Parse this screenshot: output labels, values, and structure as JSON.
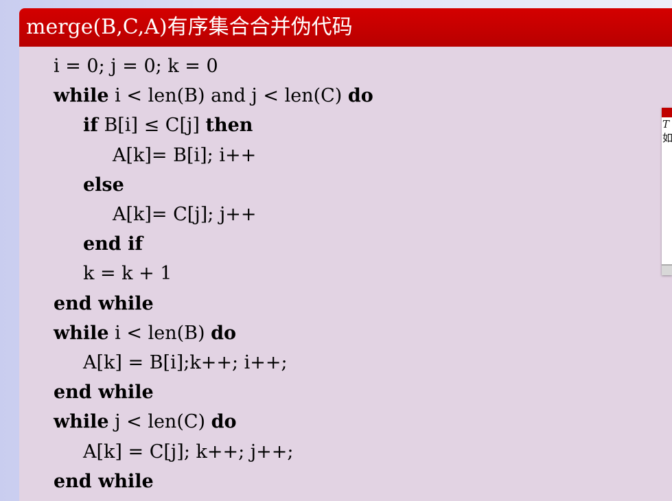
{
  "block": {
    "title": "merge(B,C,A)有序集合合并伪代码"
  },
  "code_lines": [
    {
      "indent": 0,
      "parts": [
        {
          "t": "i = 0; j = 0; k = 0",
          "b": false
        }
      ]
    },
    {
      "indent": 0,
      "parts": [
        {
          "t": "while",
          "b": true
        },
        {
          "t": " i < len(B) and j < len(C) ",
          "b": false
        },
        {
          "t": "do",
          "b": true
        }
      ]
    },
    {
      "indent": 1,
      "parts": [
        {
          "t": "if",
          "b": true
        },
        {
          "t": " B[i] ≤ C[j] ",
          "b": false
        },
        {
          "t": "then",
          "b": true
        }
      ]
    },
    {
      "indent": 2,
      "parts": [
        {
          "t": "A[k]= B[i]; i++",
          "b": false
        }
      ]
    },
    {
      "indent": 1,
      "parts": [
        {
          "t": "else",
          "b": true
        }
      ]
    },
    {
      "indent": 2,
      "parts": [
        {
          "t": "A[k]= C[j]; j++",
          "b": false
        }
      ]
    },
    {
      "indent": 1,
      "parts": [
        {
          "t": "end if",
          "b": true
        }
      ]
    },
    {
      "indent": 1,
      "parts": [
        {
          "t": "k = k + 1",
          "b": false
        }
      ]
    },
    {
      "indent": 0,
      "parts": [
        {
          "t": "end while",
          "b": true
        }
      ]
    },
    {
      "indent": 0,
      "parts": [
        {
          "t": "while",
          "b": true
        },
        {
          "t": " i < len(B) ",
          "b": false
        },
        {
          "t": "do",
          "b": true
        }
      ]
    },
    {
      "indent": 1,
      "parts": [
        {
          "t": "A[k] = B[i];k++; i++;",
          "b": false
        }
      ]
    },
    {
      "indent": 0,
      "parts": [
        {
          "t": "end while",
          "b": true
        }
      ]
    },
    {
      "indent": 0,
      "parts": [
        {
          "t": "while",
          "b": true
        },
        {
          "t": " j < len(C) ",
          "b": false
        },
        {
          "t": "do",
          "b": true
        }
      ]
    },
    {
      "indent": 1,
      "parts": [
        {
          "t": "A[k] = C[j]; k++; j++;",
          "b": false
        }
      ]
    },
    {
      "indent": 0,
      "parts": [
        {
          "t": "end while",
          "b": true
        }
      ]
    }
  ],
  "popup": {
    "line1": "T",
    "line2": "如"
  },
  "colors": {
    "title_bg": "#c00000",
    "block_bg": "#e2d3e3",
    "page_bg": "#dde0f6"
  }
}
